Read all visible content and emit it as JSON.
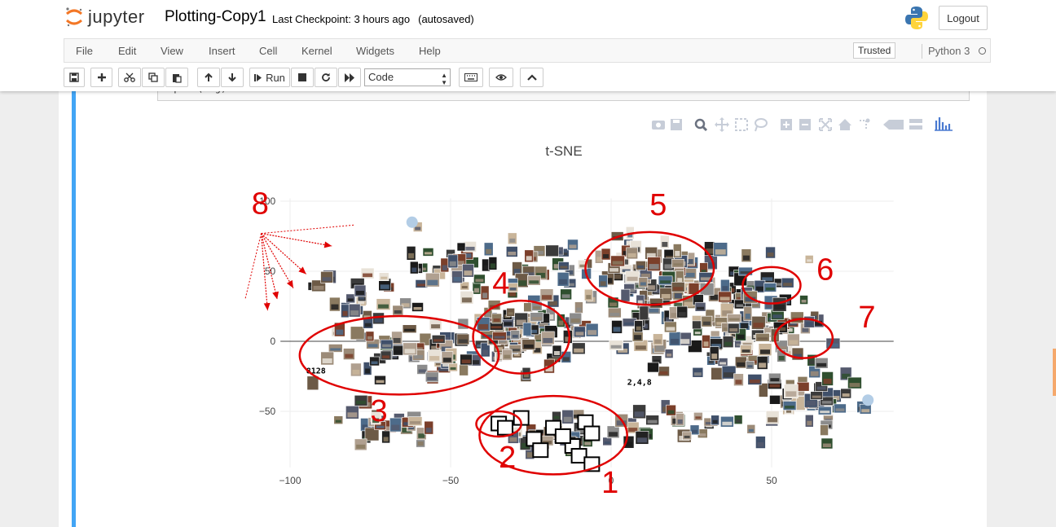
{
  "header": {
    "logo_text": "jupyter",
    "notebook_title": "Plotting-Copy1",
    "checkpoint": "Last Checkpoint: 3 hours ago",
    "autosave": "(autosaved)",
    "logout_label": "Logout"
  },
  "menu": {
    "items": [
      "File",
      "Edit",
      "View",
      "Insert",
      "Cell",
      "Kernel",
      "Widgets",
      "Help"
    ],
    "trusted_label": "Trusted",
    "kernel_name": "Python 3"
  },
  "toolbar": {
    "run_label": "Run",
    "cell_type": "Code",
    "icons": [
      "save-icon",
      "plus-icon",
      "cut-icon",
      "copy-icon",
      "paste-icon",
      "arrow-up-icon",
      "arrow-down-icon",
      "run-icon",
      "stop-icon",
      "restart-icon",
      "fast-forward-icon",
      "keyboard-icon",
      "eye-icon",
      "chevron-up-icon"
    ]
  },
  "cell": {
    "code_text": "iplot(fig)"
  },
  "plot_modebar": {
    "icons": [
      "camera-icon",
      "save-icon",
      "zoom-icon",
      "pan-icon",
      "box-select-icon",
      "lasso-icon",
      "zoom-in-icon",
      "zoom-out-icon",
      "autoscale-icon",
      "home-icon",
      "spike-lines-icon",
      "hover-closest-icon",
      "hover-compare-icon",
      "plotly-logo-icon"
    ]
  },
  "chart_data": {
    "type": "scatter",
    "title": "t-SNE",
    "xlabel": "",
    "ylabel": "",
    "xlim": [
      -103,
      88
    ],
    "ylim": [
      -90,
      102
    ],
    "x_ticks": [
      -100,
      -50,
      0,
      50
    ],
    "y_ticks": [
      100,
      50,
      0,
      -50
    ],
    "grid": true,
    "points_note": "hundreds of image thumbnails placed at t-SNE coordinates",
    "inline_labels": [
      {
        "text": "8128",
        "x": -95,
        "y": -23
      },
      {
        "text": "2,4,8",
        "x": 5,
        "y": -31
      }
    ],
    "annotations": [
      {
        "label": "1",
        "cx": -18,
        "cy": -67,
        "rx": 23,
        "ry": 28
      },
      {
        "label": "2",
        "cx": -35,
        "cy": -59,
        "rx": 7,
        "ry": 9
      },
      {
        "label": "3",
        "cx": -66,
        "cy": -10,
        "rx": 31,
        "ry": 28
      },
      {
        "label": "4",
        "cx": -28,
        "cy": 3,
        "rx": 15,
        "ry": 26
      },
      {
        "label": "5",
        "cx": 12,
        "cy": 52,
        "rx": 20,
        "ry": 26
      },
      {
        "label": "6",
        "cx": 50,
        "cy": 40,
        "rx": 9,
        "ry": 13
      },
      {
        "label": "7",
        "cx": 60,
        "cy": 2,
        "rx": 9,
        "ry": 14
      },
      {
        "label": "8",
        "cx": -100,
        "cy": 92,
        "rx": 0,
        "ry": 0
      }
    ],
    "annotation_color": "#e00000"
  },
  "colors": {
    "accent": "#42a5f5",
    "annotation": "#e00000",
    "jupyter_orange": "#f37726"
  }
}
